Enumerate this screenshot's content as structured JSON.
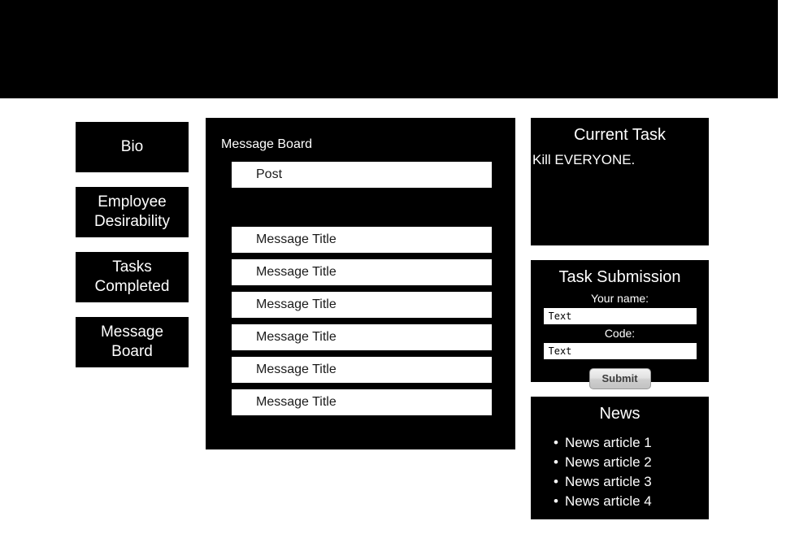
{
  "page": {
    "background_color": "#ffffff",
    "panel_color": "#000000",
    "panel_text_color": "#ffffff",
    "field_background": "#ffffff"
  },
  "header": {
    "banner_label": ""
  },
  "sidebar": {
    "items": [
      {
        "label": "Bio",
        "line1": "Bio",
        "line2": ""
      },
      {
        "label": "Employee Desirability",
        "line1": "Employee",
        "line2": "Desirability"
      },
      {
        "label": "Tasks Completed",
        "line1": "Tasks",
        "line2": "Completed"
      },
      {
        "label": "Message Board",
        "line1": "Message Board",
        "line2": ""
      }
    ]
  },
  "board": {
    "title": "Message Board",
    "post_label": "Post",
    "messages": [
      {
        "title": "Message Title"
      },
      {
        "title": "Message Title"
      },
      {
        "title": "Message Title"
      },
      {
        "title": "Message Title"
      },
      {
        "title": "Message Title"
      },
      {
        "title": "Message Title"
      }
    ]
  },
  "current_task": {
    "title": "Current Task",
    "body": "Kill EVERYONE."
  },
  "task_submission": {
    "title": "Task Submission",
    "name_label": "Your name:",
    "name_value": "Text",
    "code_label": "Code:",
    "code_value": "Text",
    "submit_label": "Submit"
  },
  "news": {
    "title": "News",
    "items": [
      {
        "label": "News article 1"
      },
      {
        "label": "News article 2"
      },
      {
        "label": "News article 3"
      },
      {
        "label": "News article 4"
      }
    ]
  }
}
